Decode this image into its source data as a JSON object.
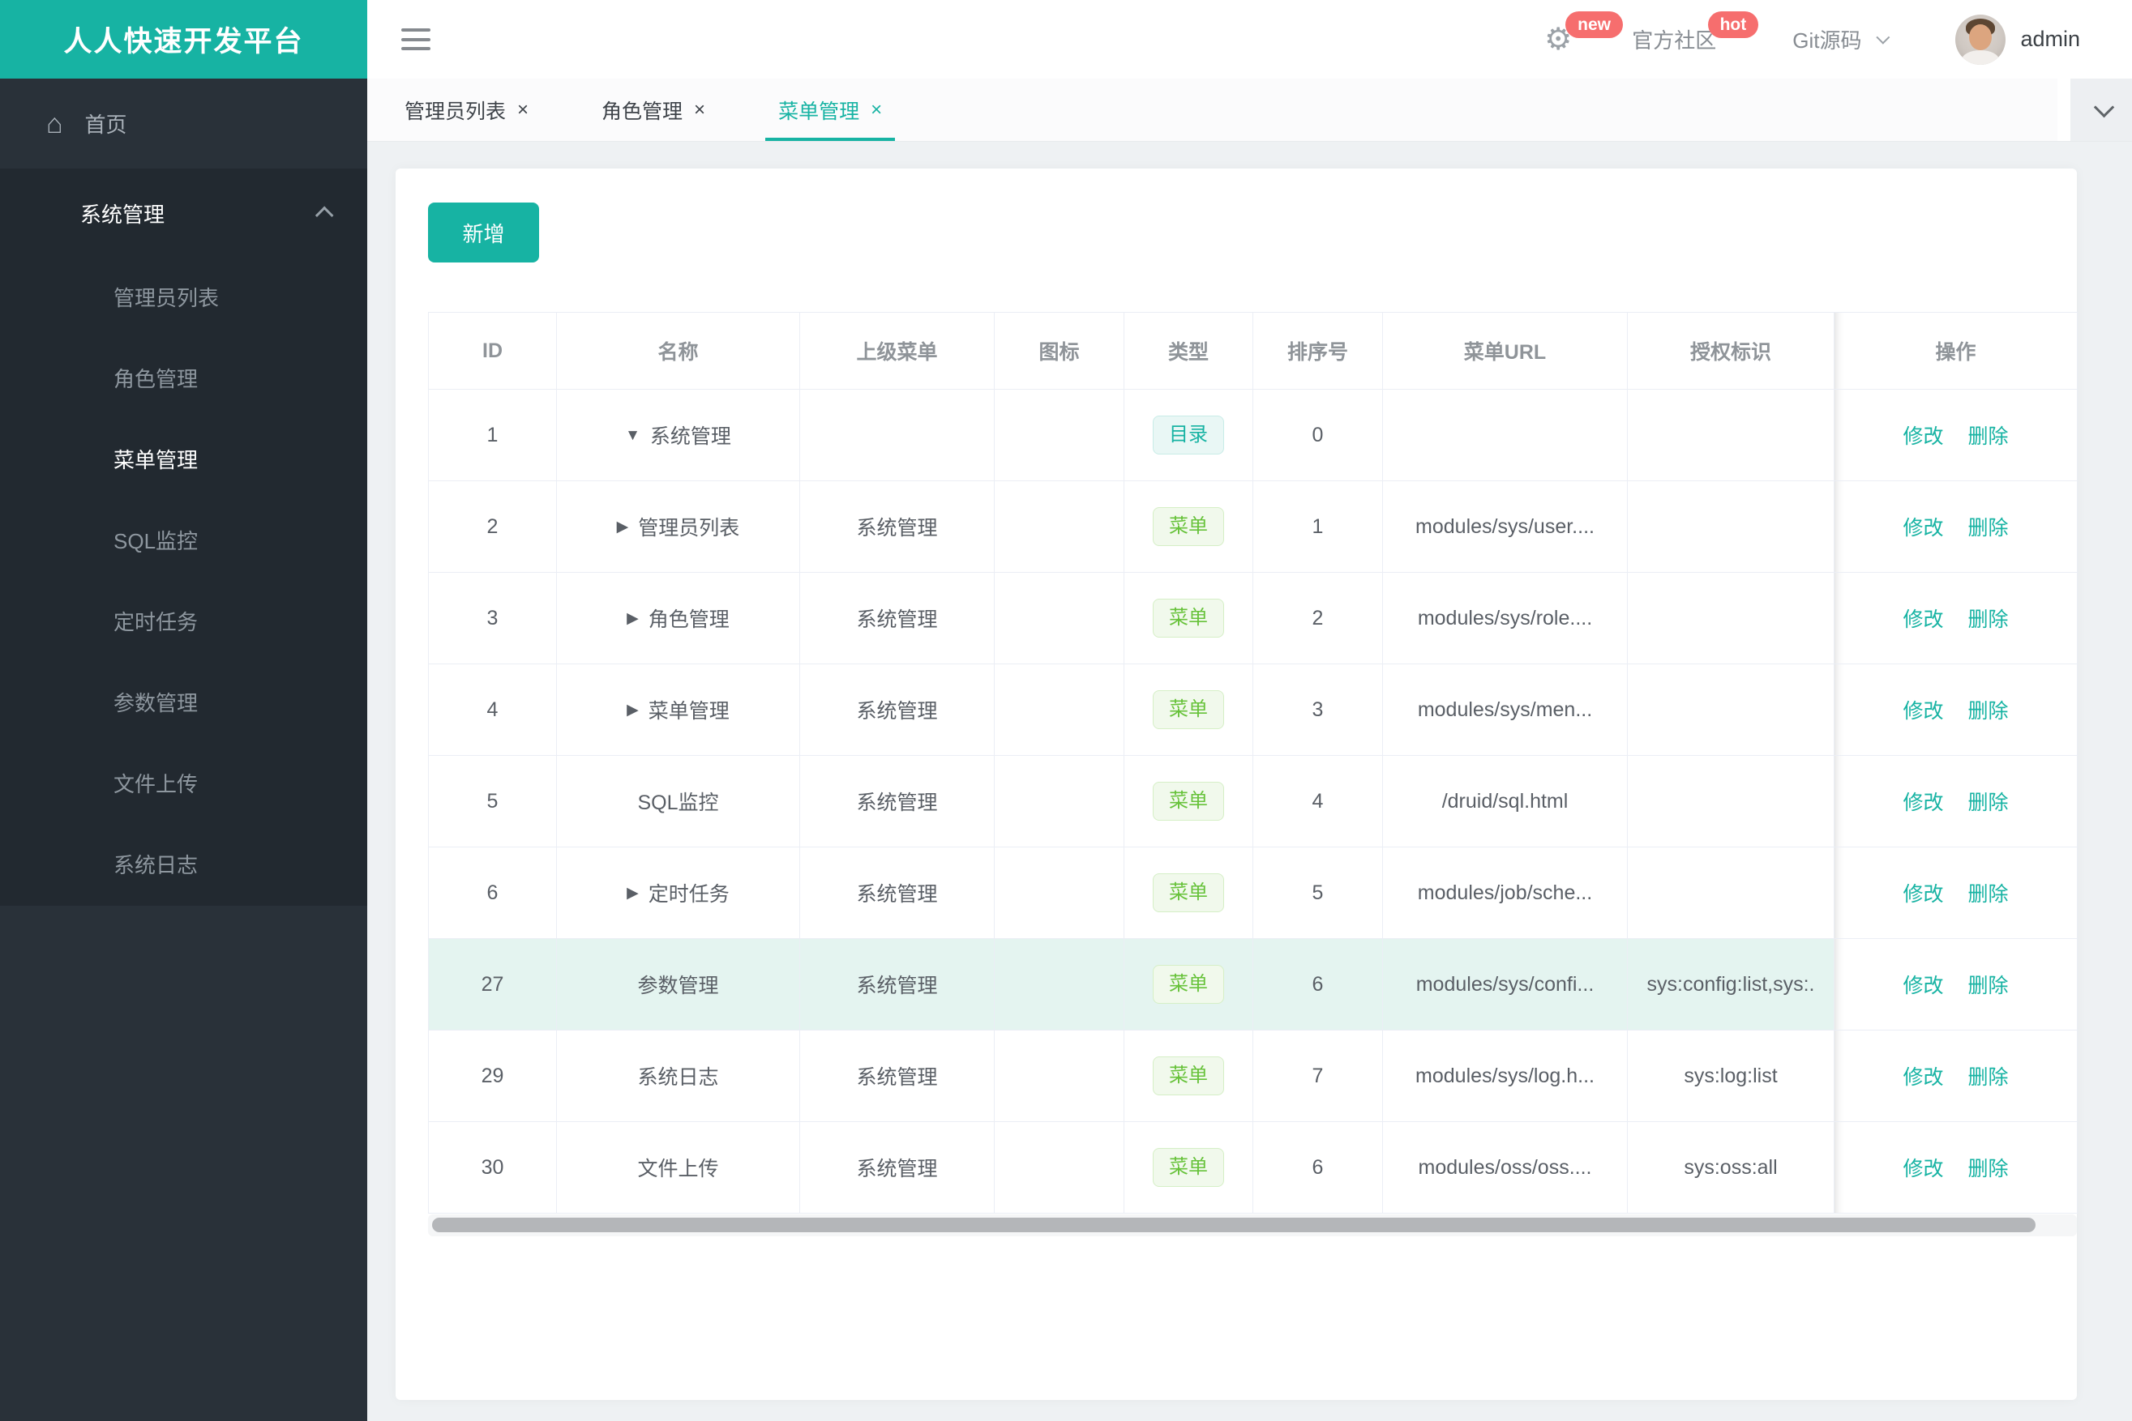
{
  "brand": {
    "title": "人人快速开发平台",
    "color": "#17b3a3"
  },
  "header": {
    "new_badge": "new",
    "hot_badge": "hot",
    "community_label": "官方社区",
    "git_label": "Git源码",
    "username": "admin"
  },
  "sidebar": {
    "home_label": "首页",
    "group": {
      "title": "系统管理",
      "items": [
        {
          "label": "管理员列表",
          "active": false
        },
        {
          "label": "角色管理",
          "active": false
        },
        {
          "label": "菜单管理",
          "active": true
        },
        {
          "label": "SQL监控",
          "active": false
        },
        {
          "label": "定时任务",
          "active": false
        },
        {
          "label": "参数管理",
          "active": false
        },
        {
          "label": "文件上传",
          "active": false
        },
        {
          "label": "系统日志",
          "active": false
        }
      ]
    }
  },
  "tabs": [
    {
      "label": "管理员列表",
      "active": false
    },
    {
      "label": "角色管理",
      "active": false
    },
    {
      "label": "菜单管理",
      "active": true
    }
  ],
  "toolbar": {
    "add_label": "新增"
  },
  "table": {
    "columns": [
      "ID",
      "名称",
      "上级菜单",
      "图标",
      "类型",
      "排序号",
      "菜单URL",
      "授权标识",
      "操作"
    ],
    "type_labels": {
      "dir": "目录",
      "menu": "菜单"
    },
    "actions": {
      "edit": "修改",
      "delete": "删除"
    },
    "rows": [
      {
        "id": "1",
        "expand": "down",
        "name": "系统管理",
        "parent": "",
        "icon": "",
        "type": "dir",
        "order": "0",
        "url": "",
        "perms": "",
        "highlighted": false
      },
      {
        "id": "2",
        "expand": "right",
        "name": "管理员列表",
        "parent": "系统管理",
        "icon": "",
        "type": "menu",
        "order": "1",
        "url": "modules/sys/user....",
        "perms": "",
        "highlighted": false
      },
      {
        "id": "3",
        "expand": "right",
        "name": "角色管理",
        "parent": "系统管理",
        "icon": "",
        "type": "menu",
        "order": "2",
        "url": "modules/sys/role....",
        "perms": "",
        "highlighted": false
      },
      {
        "id": "4",
        "expand": "right",
        "name": "菜单管理",
        "parent": "系统管理",
        "icon": "",
        "type": "menu",
        "order": "3",
        "url": "modules/sys/men...",
        "perms": "",
        "highlighted": false
      },
      {
        "id": "5",
        "expand": "none",
        "name": "SQL监控",
        "parent": "系统管理",
        "icon": "",
        "type": "menu",
        "order": "4",
        "url": "/druid/sql.html",
        "perms": "",
        "highlighted": false
      },
      {
        "id": "6",
        "expand": "right",
        "name": "定时任务",
        "parent": "系统管理",
        "icon": "",
        "type": "menu",
        "order": "5",
        "url": "modules/job/sche...",
        "perms": "",
        "highlighted": false
      },
      {
        "id": "27",
        "expand": "none",
        "name": "参数管理",
        "parent": "系统管理",
        "icon": "",
        "type": "menu",
        "order": "6",
        "url": "modules/sys/confi...",
        "perms": "sys:config:list,sys:.",
        "highlighted": true
      },
      {
        "id": "29",
        "expand": "none",
        "name": "系统日志",
        "parent": "系统管理",
        "icon": "",
        "type": "menu",
        "order": "7",
        "url": "modules/sys/log.h...",
        "perms": "sys:log:list",
        "highlighted": false
      },
      {
        "id": "30",
        "expand": "none",
        "name": "文件上传",
        "parent": "系统管理",
        "icon": "",
        "type": "menu",
        "order": "6",
        "url": "modules/oss/oss....",
        "perms": "sys:oss:all",
        "highlighted": false
      }
    ]
  },
  "icons": {
    "close": "×",
    "arrow_down": "▼",
    "arrow_right": "▶",
    "home": "⌂",
    "gear": "⚙"
  }
}
